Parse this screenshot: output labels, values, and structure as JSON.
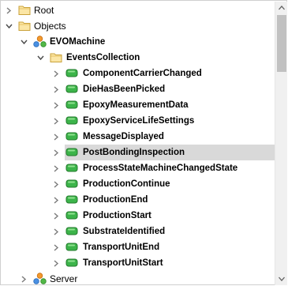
{
  "tree": {
    "root": {
      "label": "Root",
      "icon": "folder-icon",
      "expanded": false
    },
    "objects": {
      "label": "Objects",
      "icon": "folder-icon",
      "expanded": true
    },
    "machine": {
      "label": "EVOMachine",
      "icon": "object-cluster-icon",
      "expanded": true
    },
    "events_collection": {
      "label": "EventsCollection",
      "icon": "folder-icon",
      "expanded": true
    },
    "events": [
      {
        "label": "ComponentCarrierChanged",
        "icon": "event-icon",
        "selected": false
      },
      {
        "label": "DieHasBeenPicked",
        "icon": "event-icon",
        "selected": false
      },
      {
        "label": "EpoxyMeasurementData",
        "icon": "event-icon",
        "selected": false
      },
      {
        "label": "EpoxyServiceLifeSettings",
        "icon": "event-icon",
        "selected": false
      },
      {
        "label": "MessageDisplayed",
        "icon": "event-icon",
        "selected": false
      },
      {
        "label": "PostBondingInspection",
        "icon": "event-icon",
        "selected": true
      },
      {
        "label": "ProcessStateMachineChangedState",
        "icon": "event-icon",
        "selected": false
      },
      {
        "label": "ProductionContinue",
        "icon": "event-icon",
        "selected": false
      },
      {
        "label": "ProductionEnd",
        "icon": "event-icon",
        "selected": false
      },
      {
        "label": "ProductionStart",
        "icon": "event-icon",
        "selected": false
      },
      {
        "label": "SubstrateIdentified",
        "icon": "event-icon",
        "selected": false
      },
      {
        "label": "TransportUnitEnd",
        "icon": "event-icon",
        "selected": false
      },
      {
        "label": "TransportUnitStart",
        "icon": "event-icon",
        "selected": false
      }
    ],
    "server": {
      "label": "Server",
      "icon": "object-cluster-icon",
      "expanded": false
    }
  },
  "colors": {
    "selection": "#d9d9d9",
    "event_green": "#3cb44a",
    "folder_yellow": "#f0c85a"
  }
}
